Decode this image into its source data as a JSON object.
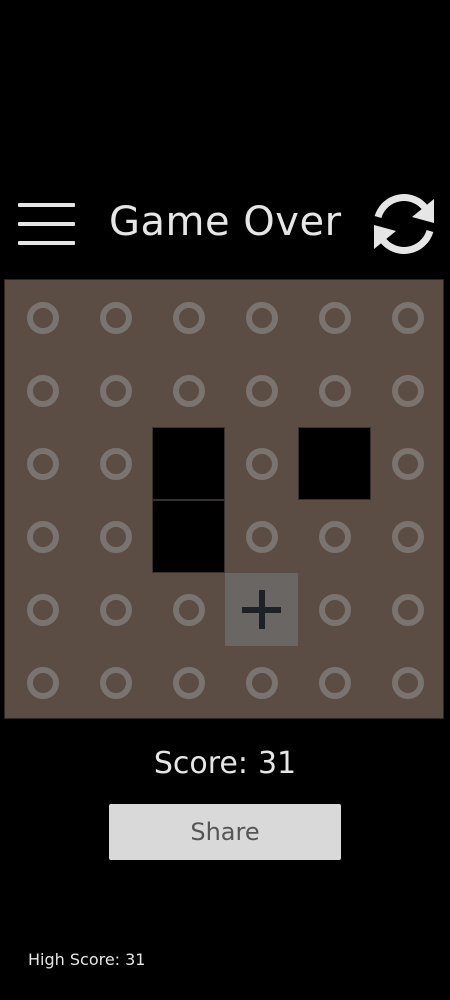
{
  "header": {
    "title": "Game Over",
    "menu_icon": "hamburger-menu-icon",
    "refresh_icon": "refresh-icon"
  },
  "board": {
    "rows": 6,
    "cols": 6,
    "cells": [
      [
        "empty",
        "empty",
        "empty",
        "empty",
        "empty",
        "empty"
      ],
      [
        "empty",
        "empty",
        "empty",
        "empty",
        "empty",
        "empty"
      ],
      [
        "empty",
        "empty",
        "black",
        "empty",
        "black",
        "empty"
      ],
      [
        "empty",
        "empty",
        "black",
        "empty",
        "empty",
        "empty"
      ],
      [
        "empty",
        "empty",
        "empty",
        "add",
        "empty",
        "empty"
      ],
      [
        "empty",
        "empty",
        "empty",
        "empty",
        "empty",
        "empty"
      ]
    ],
    "colors": {
      "board": "#5c4d44",
      "ring": "#7a7470",
      "block": "#000000",
      "add_tile": "#6a6663",
      "plus": "#1e2126"
    }
  },
  "score": {
    "label": "Score:",
    "value": "31"
  },
  "share_label": "Share",
  "high_score": {
    "label": "High Score:",
    "value": "31"
  }
}
